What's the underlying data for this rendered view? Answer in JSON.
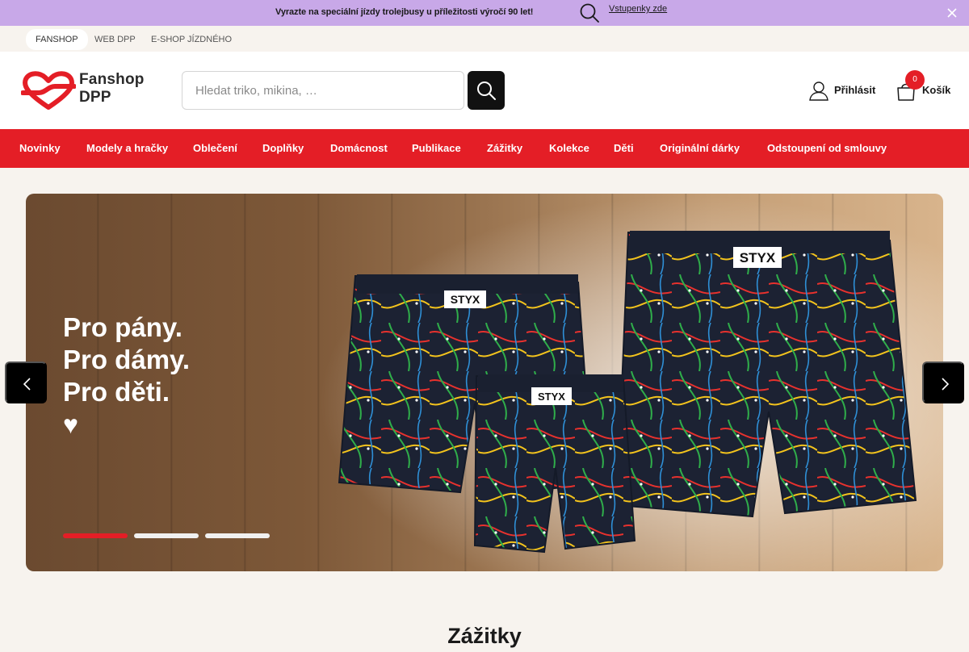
{
  "announcement": {
    "text": "Vyrazte na speciální jízdy trolejbusy u příležitosti výročí 90 let!",
    "link_label": "Vstupenky zde"
  },
  "top_links": [
    {
      "label": "FANSHOP",
      "active": true
    },
    {
      "label": "WEB DPP",
      "active": false
    },
    {
      "label": "E-SHOP JÍZDNÉHO",
      "active": false
    }
  ],
  "header": {
    "logo_line1": "Fanshop",
    "logo_line2": "DPP",
    "search_placeholder": "Hledat triko, mikina, …",
    "login_label": "Přihlásit",
    "cart_label": "Košík",
    "cart_count": "0"
  },
  "nav": {
    "items": [
      {
        "label": "Novinky"
      },
      {
        "label": "Modely a hračky"
      },
      {
        "label": "Oblečení"
      },
      {
        "label": "Doplňky"
      },
      {
        "label": "Domácnost"
      },
      {
        "label": "Publikace"
      },
      {
        "label": "Zážitky"
      },
      {
        "label": "Kolekce"
      },
      {
        "label": "Děti"
      },
      {
        "label": "Originální dárky"
      },
      {
        "label": "Odstoupení od smlouvy"
      }
    ]
  },
  "hero": {
    "line1": "Pro pány.",
    "line2": "Pro dámy.",
    "line3": "Pro děti.",
    "heart": "♥",
    "brand_text": "STYX",
    "slide_count": 3,
    "active_slide": 1
  },
  "section": {
    "title": "Zážitky"
  },
  "colors": {
    "brand_red": "#e41e26",
    "announcement_bg": "#c8a8e8",
    "page_bg": "#f7f3ee"
  }
}
